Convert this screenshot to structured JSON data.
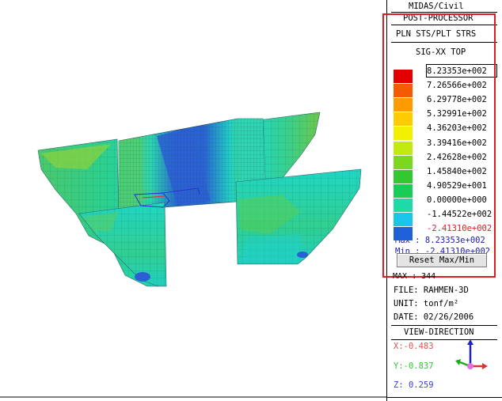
{
  "panel": {
    "program": "MIDAS/Civil",
    "mode": "POST-PROCESSOR",
    "result_type": "PLN STS/PLT STRS",
    "component": "SIG-XX TOP"
  },
  "legend": {
    "levels": [
      {
        "value": "8.23353e+002",
        "color": "#e30000"
      },
      {
        "value": "7.26566e+002",
        "color": "#f45a00"
      },
      {
        "value": "6.29778e+002",
        "color": "#ff9b00"
      },
      {
        "value": "5.32991e+002",
        "color": "#ffcc00"
      },
      {
        "value": "4.36203e+002",
        "color": "#f2ef00"
      },
      {
        "value": "3.39416e+002",
        "color": "#c2ea12"
      },
      {
        "value": "2.42628e+002",
        "color": "#7cd81e"
      },
      {
        "value": "1.45840e+002",
        "color": "#33c82f"
      },
      {
        "value": "4.90529e+001",
        "color": "#19cc55"
      },
      {
        "value": "0.00000e+000",
        "color": "#1fd9a6"
      },
      {
        "value": "-1.44522e+002",
        "color": "#19c6e8"
      },
      {
        "value": "-2.41310e+002",
        "color": "#1f5fd8"
      }
    ],
    "max_label": "Max : 8.23353e+002",
    "min_label": "Min : -2.41310e+002",
    "reset_button": "Reset Max/Min",
    "max_color": "#1a1ab4",
    "min_value_color": "#d81e24"
  },
  "info": {
    "partial_line": "MAX : 344",
    "file": "FILE: RAHMEN-3D",
    "unit": "UNIT: tonf/m²",
    "date": "DATE: 02/26/2006"
  },
  "view": {
    "title": "VIEW-DIRECTION",
    "x": "X:-0.483",
    "y": "Y:-0.837",
    "z": "Z: 0.259",
    "x_color": "#e05050",
    "y_color": "#2ec82e",
    "z_color": "#3a3ae0"
  },
  "highlight_color": "#d81e24"
}
